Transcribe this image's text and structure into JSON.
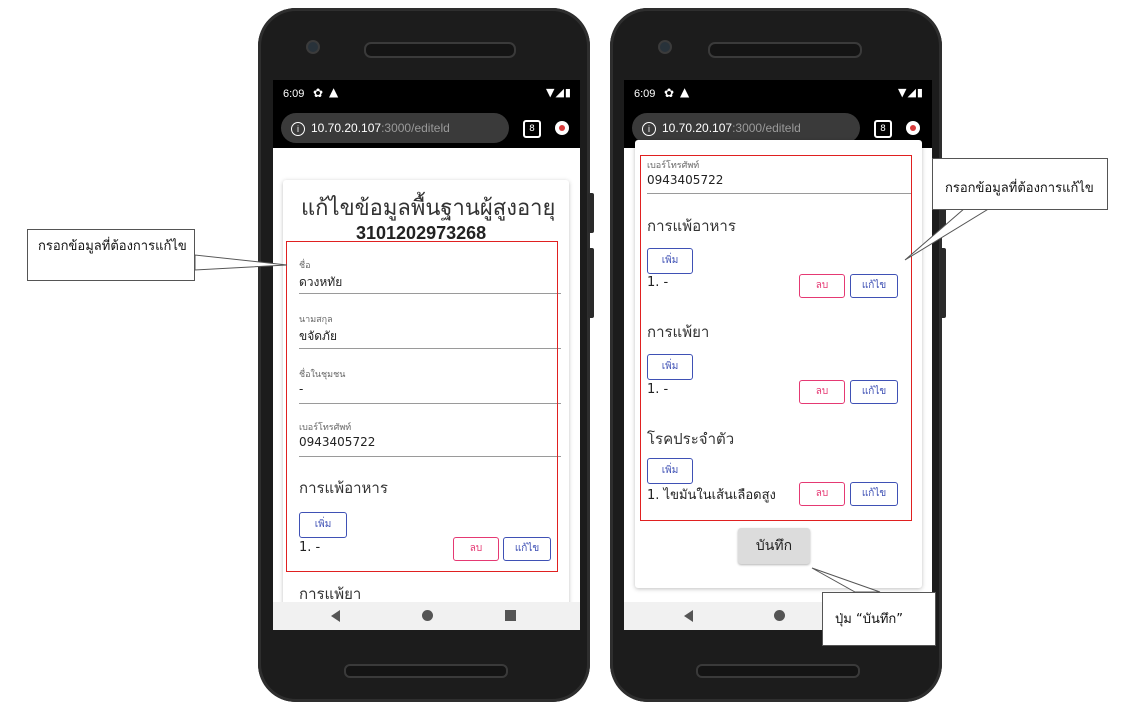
{
  "phone_left": {
    "status": {
      "time": "6:09",
      "gear_icon": "gear-icon",
      "warning_icon": "warning-icon"
    },
    "url": {
      "host": "10.70.20.107",
      "path": ":3000/editeld",
      "tab_count": "8"
    },
    "form": {
      "title": "แก้ไขข้อมูลพื้นฐานผู้สูงอายุ",
      "id_number": "3101202973268",
      "fields": [
        {
          "label": "ชื่อ",
          "value": "ดวงหทัย"
        },
        {
          "label": "นามสกุล",
          "value": "ขจัดภัย"
        },
        {
          "label": "ชื่อในชุมชน",
          "value": "-"
        },
        {
          "label": "เบอร์โทรศัพท์",
          "value": "0943405722"
        }
      ],
      "food_allergy": {
        "heading": "การแพ้อาหาร",
        "add_label": "เพิ่ม",
        "item": "1. -",
        "delete_label": "ลบ",
        "edit_label": "แก้ไข"
      },
      "drug_allergy_heading": "การแพ้ยา"
    }
  },
  "phone_right": {
    "status": {
      "time": "6:09",
      "gear_icon": "gear-icon",
      "warning_icon": "warning-icon"
    },
    "url": {
      "host": "10.70.20.107",
      "path": ":3000/editeld",
      "tab_count": "8"
    },
    "form": {
      "phone_label": "เบอร์โทรศัพท์",
      "phone_value": "0943405722",
      "food_allergy": {
        "heading": "การแพ้อาหาร",
        "add_label": "เพิ่ม",
        "item": "1. -",
        "delete_label": "ลบ",
        "edit_label": "แก้ไข"
      },
      "drug_allergy": {
        "heading": "การแพ้ยา",
        "add_label": "เพิ่ม",
        "item": "1. -",
        "delete_label": "ลบ",
        "edit_label": "แก้ไข"
      },
      "chronic_disease": {
        "heading": "โรคประจำตัว",
        "add_label": "เพิ่ม",
        "item": "1. ไขมันในเส้นเลือดสูง",
        "delete_label": "ลบ",
        "edit_label": "แก้ไข"
      },
      "save_label": "บันทึก"
    }
  },
  "callouts": {
    "left": "กรอกข้อมูลที่ต้องการแก้ไข",
    "right": "กรอกข้อมูลที่ต้องการแก้ไข",
    "save": "ปุ่ม “บันทึก”"
  },
  "colors": {
    "highlight_box": "#e02020",
    "primary": "#3f51b5",
    "danger": "#e53973"
  }
}
